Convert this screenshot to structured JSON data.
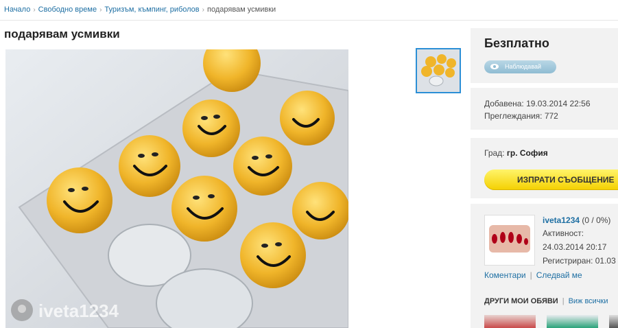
{
  "breadcrumb": {
    "items": [
      "Начало",
      "Свободно време",
      "Туризъм, къмпинг, риболов"
    ],
    "current": "подарявам усмивки"
  },
  "listing": {
    "title": "подарявам усмивки",
    "watermark": "iveta1234"
  },
  "sidebar": {
    "price": "Безплатно",
    "watch_label": "Наблюдавай",
    "added": "Добавена: 19.03.2014 22:56",
    "views": "Преглеждания: 772",
    "city_label": "Град:",
    "city_value": "гр. София",
    "send_label": "ИЗПРАТИ СЪОБЩЕНИЕ"
  },
  "user": {
    "name": "iveta1234",
    "rating": "(0 / 0%)",
    "activity_label": "Активност:",
    "activity_value": "24.03.2014 20:17",
    "registered": "Регистриран: 01.03",
    "comments_link": "Коментари",
    "follow_link": "Следвай ме"
  },
  "other_ads": {
    "heading": "ДРУГИ МОИ ОБЯВИ",
    "see_all": "Виж всички"
  },
  "colors": {
    "link": "#1e6fa3",
    "panel_bg": "#f2f2f2",
    "send_button": "#f4d000",
    "thumb_border": "#2b8fd6"
  }
}
